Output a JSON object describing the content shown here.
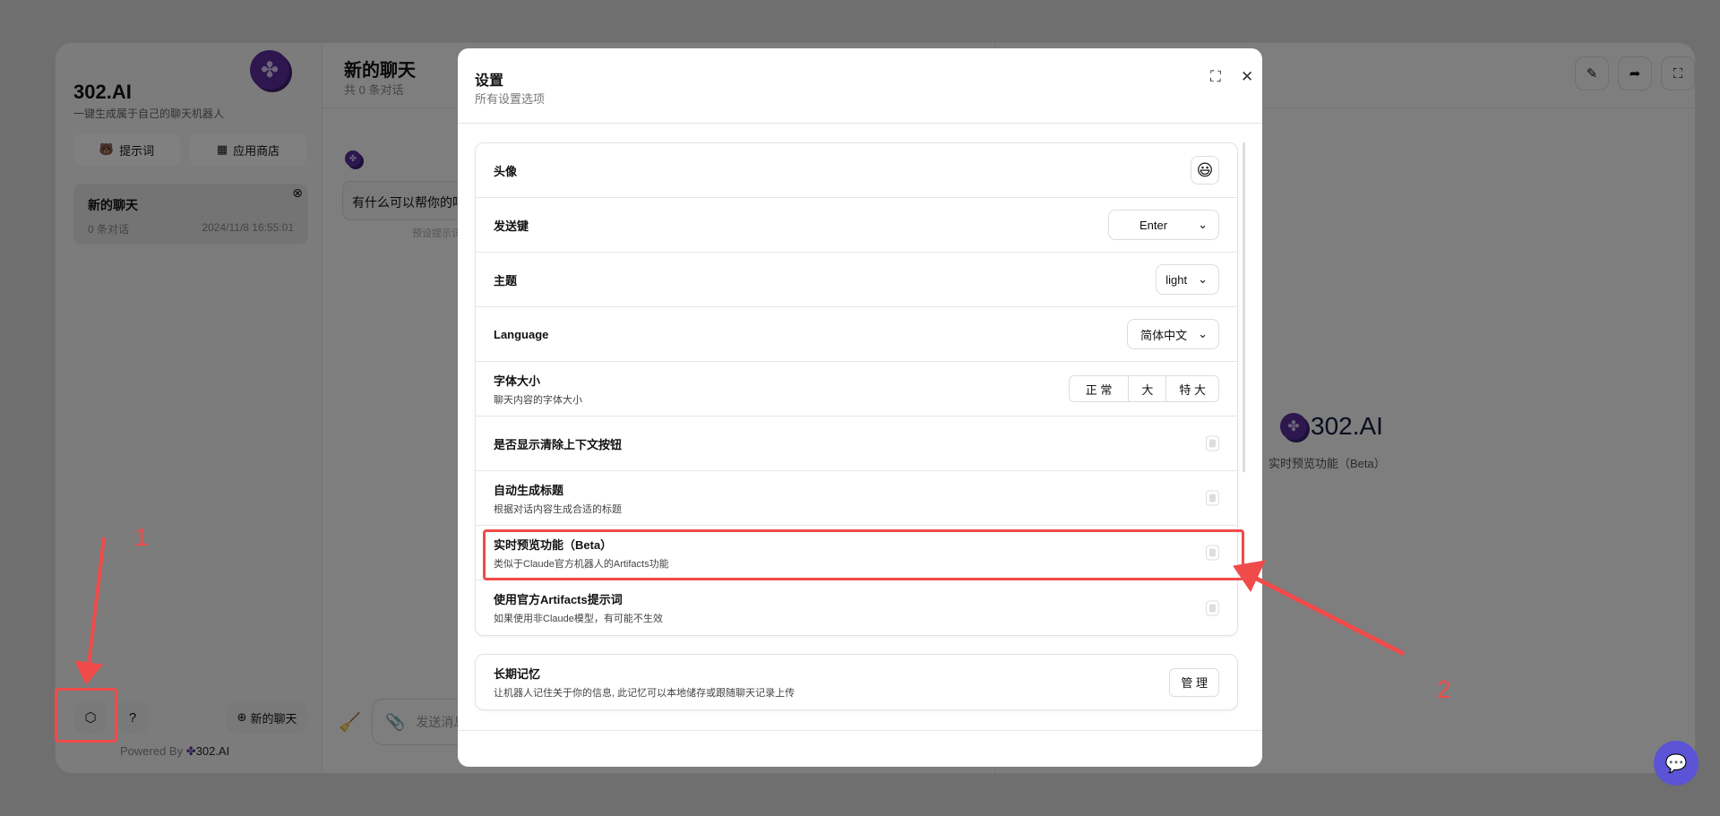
{
  "sidebar": {
    "brand": "302.AI",
    "tagline": "一键生成属于自己的聊天机器人",
    "prompt_button": "提示词",
    "store_button": "应用商店",
    "chats": [
      {
        "title": "新的聊天",
        "count": "0 条对话",
        "date": "2024/11/8 16:55:01"
      }
    ],
    "new_chat_button": "新的聊天",
    "powered_by": "Powered By",
    "powered_brand": "302.AI"
  },
  "chat": {
    "title": "新的聊天",
    "subtitle": "共 0 条对话",
    "greeting": "有什么可以帮你的吗",
    "preset_hint": "预设提示词",
    "input_placeholder": "发送消息"
  },
  "preview": {
    "brand": "302.AI",
    "label": "实时预览功能（Beta）"
  },
  "modal": {
    "title": "设置",
    "subtitle": "所有设置选项",
    "avatar": {
      "label": "头像",
      "value": "😃"
    },
    "send_key": {
      "label": "发送键",
      "value": "Enter"
    },
    "theme": {
      "label": "主题",
      "value": "light"
    },
    "language": {
      "label": "Language",
      "value": "简体中文"
    },
    "font_size": {
      "label": "字体大小",
      "desc": "聊天内容的字体大小",
      "options": [
        "正 常",
        "大",
        "特 大"
      ]
    },
    "toggles": [
      {
        "label": "是否显示清除上下文按钮",
        "desc": "",
        "checked": false
      },
      {
        "label": "自动生成标题",
        "desc": "根据对话内容生成合适的标题",
        "checked": false
      },
      {
        "label": "实时预览功能（Beta）",
        "desc": "类似于Claude官方机器人的Artifacts功能",
        "checked": false
      },
      {
        "label": "使用官方Artifacts提示词",
        "desc": "如果使用非Claude模型，有可能不生效",
        "checked": false
      }
    ],
    "memory": {
      "label": "长期记忆",
      "desc": "让机器人记住关于你的信息, 此记忆可以本地储存或跟随聊天记录上传",
      "button": "管 理"
    }
  },
  "annotations": [
    "1",
    "2"
  ],
  "colors": {
    "brand": "#5b2d9c",
    "annotation": "#f04a4a",
    "fab": "#5b54d6"
  }
}
